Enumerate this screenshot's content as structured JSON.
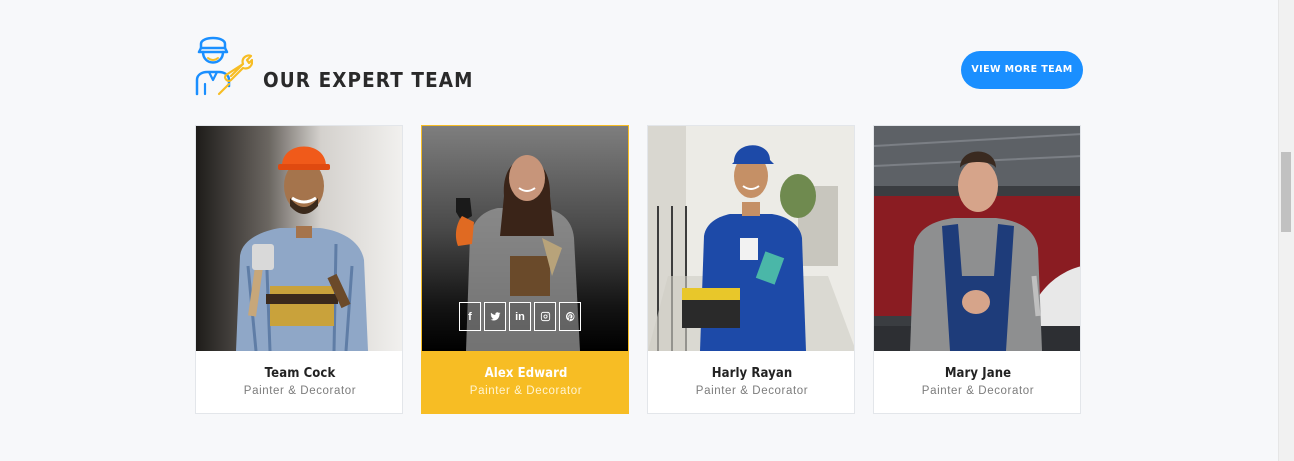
{
  "section": {
    "title": "OUR EXPERT TEAM",
    "view_more_label": "VIEW MORE TEAM",
    "icon": "worker-wrench-icon"
  },
  "team": [
    {
      "name": "Team Cock",
      "role": "Painter & Decorator",
      "active": false
    },
    {
      "name": "Alex Edward",
      "role": "Painter & Decorator",
      "active": true
    },
    {
      "name": "Harly Rayan",
      "role": "Painter & Decorator",
      "active": false
    },
    {
      "name": "Mary Jane",
      "role": "Painter & Decorator",
      "active": false
    }
  ],
  "socials": [
    {
      "icon": "facebook-icon",
      "glyph": "f"
    },
    {
      "icon": "twitter-icon",
      "glyph": ""
    },
    {
      "icon": "linkedin-icon",
      "glyph": "in"
    },
    {
      "icon": "instagram-icon",
      "glyph": ""
    },
    {
      "icon": "pinterest-icon",
      "glyph": "P"
    }
  ],
  "colors": {
    "accent_yellow": "#f7bd24",
    "button_blue": "#1a8fff",
    "background": "#f7f8fa"
  }
}
